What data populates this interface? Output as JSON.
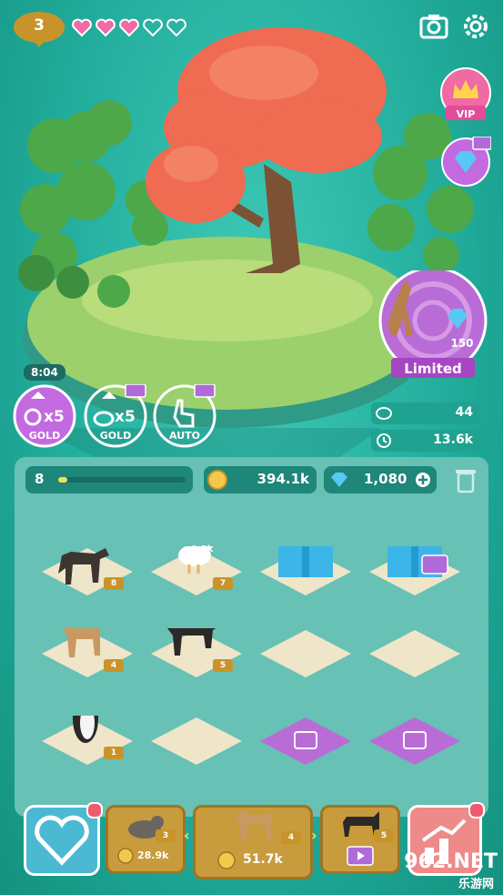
{
  "hud": {
    "level": "3",
    "hearts_filled": 3,
    "hearts_total": 5,
    "icons": [
      "camera-icon",
      "gear-icon"
    ]
  },
  "side": {
    "vip_label": "VIP",
    "limited_label": "Limited",
    "limited_gems": "150",
    "timer": "8:04"
  },
  "boosts": [
    {
      "multiplier": "x5",
      "label": "GOLD"
    },
    {
      "multiplier": "x5",
      "label": "GOLD"
    },
    {
      "label": "AUTO"
    }
  ],
  "stats": {
    "taps_per_sec": "44",
    "timed_value": "13.6k"
  },
  "board": {
    "level": "8",
    "level_progress": 0.07,
    "coins": "394.1k",
    "gems": "1,080"
  },
  "tiles": [
    {
      "animal": "dog",
      "level": "8"
    },
    {
      "animal": "chicken",
      "level": "7",
      "floating": "0.2k"
    },
    {
      "animal": "gift-box"
    },
    {
      "animal": "gift-box-video"
    },
    {
      "animal": "fawn",
      "level": "4"
    },
    {
      "animal": "cat",
      "level": "5"
    },
    {
      "animal": "empty"
    },
    {
      "animal": "empty"
    },
    {
      "animal": "penguin",
      "level": "1"
    },
    {
      "animal": "empty"
    },
    {
      "animal": "video"
    },
    {
      "animal": "video"
    }
  ],
  "bottom": {
    "left_card": {
      "level": "3",
      "price": "28.9k"
    },
    "center_card": {
      "level": "4",
      "price": "51.7k"
    },
    "right_card": {
      "level": "5"
    },
    "watermark": "962.NET",
    "watermark_sub": "乐游网"
  },
  "colors": {
    "accent_pink": "#e24c9a",
    "gold": "#c89b3c",
    "purple": "#b96cd6"
  }
}
